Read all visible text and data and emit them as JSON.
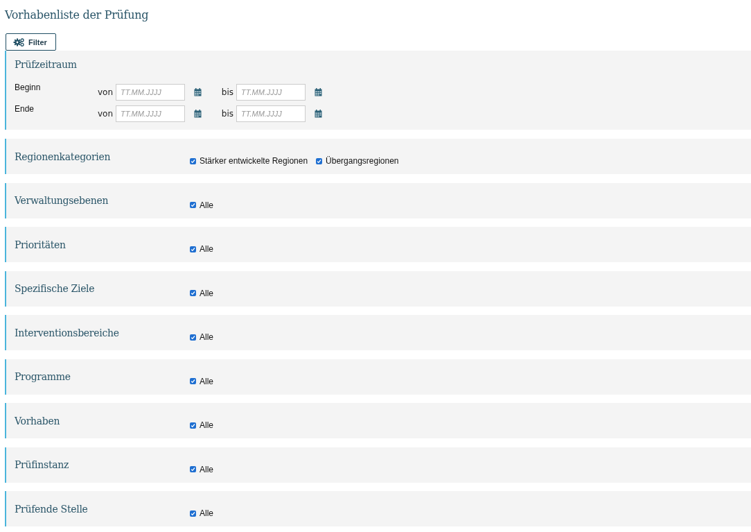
{
  "title": "Vorhabenliste der Prüfung",
  "filter_button": "Filter",
  "period": {
    "heading": "Prüfzeitraum",
    "rows": [
      {
        "label": "Beginn",
        "from": {
          "label": "von",
          "placeholder": "TT.MM.JJJJ"
        },
        "to": {
          "label": "bis",
          "placeholder": "TT.MM.JJJJ"
        }
      },
      {
        "label": "Ende",
        "from": {
          "label": "von",
          "placeholder": "TT.MM.JJJJ"
        },
        "to": {
          "label": "bis",
          "placeholder": "TT.MM.JJJJ"
        }
      }
    ]
  },
  "sections": [
    {
      "heading": "Regionenkategorien",
      "options": [
        {
          "label": "Stärker entwickelte Regionen",
          "checked": true
        },
        {
          "label": "Übergangsregionen",
          "checked": true
        }
      ]
    },
    {
      "heading": "Verwaltungsebenen",
      "options": [
        {
          "label": "Alle",
          "checked": true
        }
      ]
    },
    {
      "heading": "Prioritäten",
      "options": [
        {
          "label": "Alle",
          "checked": true
        }
      ]
    },
    {
      "heading": "Spezifische Ziele",
      "options": [
        {
          "label": "Alle",
          "checked": true
        }
      ]
    },
    {
      "heading": "Interventionsbereiche",
      "options": [
        {
          "label": "Alle",
          "checked": true
        }
      ]
    },
    {
      "heading": "Programme",
      "options": [
        {
          "label": "Alle",
          "checked": true
        }
      ]
    },
    {
      "heading": "Vorhaben",
      "options": [
        {
          "label": "Alle",
          "checked": true
        }
      ]
    },
    {
      "heading": "Prüfinstanz",
      "options": [
        {
          "label": "Alle",
          "checked": true
        }
      ]
    },
    {
      "heading": "Prüfende Stelle",
      "options": [
        {
          "label": "Alle",
          "checked": true
        }
      ]
    }
  ]
}
